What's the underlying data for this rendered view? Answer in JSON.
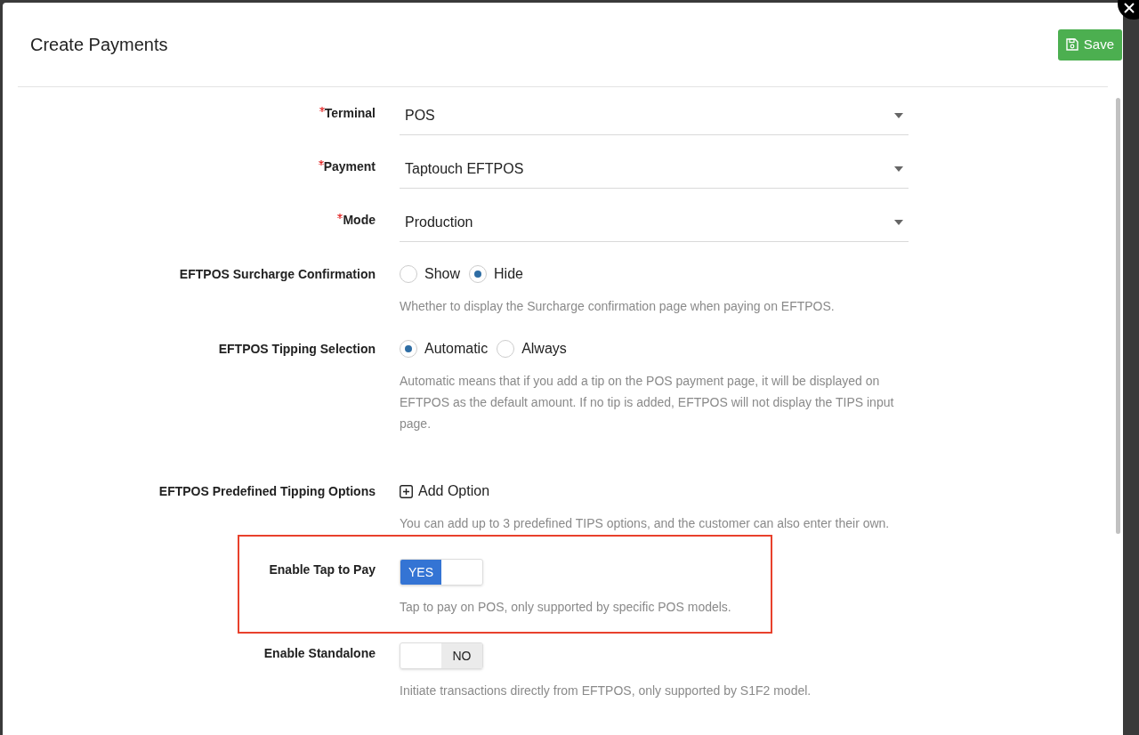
{
  "modal": {
    "title": "Create Payments",
    "save_label": "Save"
  },
  "fields": [
    {
      "kind": "select",
      "label": "Terminal",
      "required": true,
      "highlighted": false,
      "value": "POS"
    },
    {
      "kind": "select",
      "label": "Payment",
      "required": true,
      "highlighted": false,
      "value": "Taptouch EFTPOS"
    },
    {
      "kind": "select",
      "label": "Mode",
      "required": true,
      "highlighted": false,
      "value": "Production"
    },
    {
      "kind": "radio",
      "label": "EFTPOS Surcharge Confirmation",
      "required": false,
      "highlighted": false,
      "options": [
        {
          "label": "Show",
          "selected": false
        },
        {
          "label": "Hide",
          "selected": true
        }
      ],
      "help": "Whether to display the Surcharge confirmation page when paying on EFTPOS."
    },
    {
      "kind": "radio",
      "label": "EFTPOS Tipping Selection",
      "required": false,
      "highlighted": false,
      "options": [
        {
          "label": "Automatic",
          "selected": true
        },
        {
          "label": "Always",
          "selected": false
        }
      ],
      "help": "Automatic means that if you add a tip on the POS payment page, it will be displayed on EFTPOS as the default amount. If no tip is added, EFTPOS will not display the TIPS input page."
    },
    {
      "kind": "add",
      "label": "EFTPOS Predefined Tipping Options",
      "required": false,
      "highlighted": false,
      "action": "Add Option",
      "help": "You can add up to 3 predefined TIPS options, and the customer can also enter their own."
    },
    {
      "kind": "toggle",
      "label": "Enable Tap to Pay",
      "required": false,
      "highlighted": true,
      "on": true,
      "state_label": "YES",
      "help": "Tap to pay on POS, only supported by specific POS models."
    },
    {
      "kind": "toggle",
      "label": "Enable Standalone",
      "required": false,
      "highlighted": false,
      "on": false,
      "state_label": "NO",
      "help": "Initiate transactions directly from EFTPOS, only supported by S1F2 model."
    }
  ]
}
